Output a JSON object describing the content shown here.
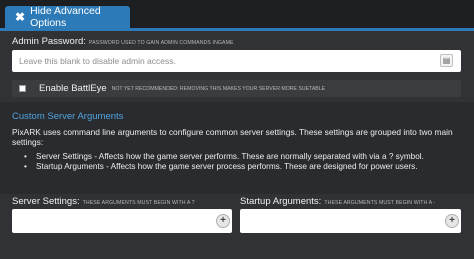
{
  "tab": {
    "label": "Hide Advanced Options",
    "icon": "close-icon"
  },
  "admin_password": {
    "label": "Admin Password:",
    "hint": "PASSWORD USED TO GAIN ADMIN COMMANDS INGAME",
    "placeholder": "Leave this blank to disable admin access.",
    "value": ""
  },
  "battleye": {
    "label": "Enable BattlEye",
    "hint": "NOT YET RECOMMENDED: REMOVING THIS MAKES YOUR SERVER MORE SUETABLE",
    "checked": false
  },
  "custom_args": {
    "title": "Custom Server Arguments",
    "description": "PixARK uses command line arguments to configure common server settings. These settings are grouped into two main settings:",
    "bullets": [
      "Server Settings - Affects how the game server performs. These are normally separated with via a ? symbol.",
      "Startup Arguments - Affects how the game server process performs. These are designed for power users."
    ]
  },
  "server_settings": {
    "label": "Server Settings:",
    "hint": "THESE ARGUMENTS MUST BEGIN WITH A ?",
    "value": ""
  },
  "startup_arguments": {
    "label": "Startup Arguments:",
    "hint": "THESE ARGUMENTS MUST BEGIN WITH A -",
    "value": ""
  },
  "colors": {
    "accent": "#2c7ab8",
    "link": "#4fa3e0",
    "panel": "#303236",
    "background": "#1e1f22"
  }
}
